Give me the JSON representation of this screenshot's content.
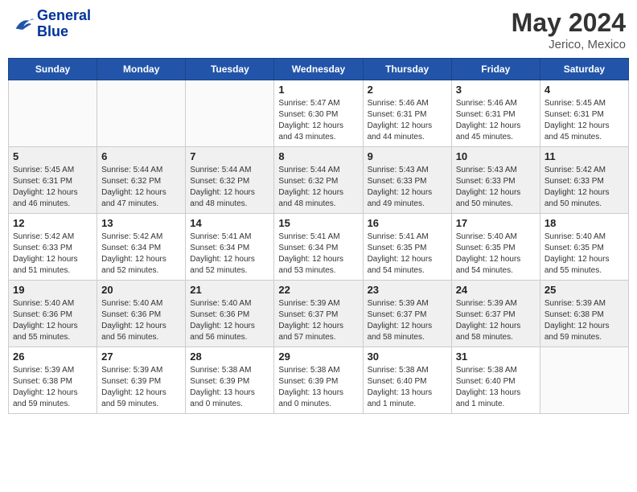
{
  "header": {
    "logo_line1": "General",
    "logo_line2": "Blue",
    "month_year": "May 2024",
    "location": "Jerico, Mexico"
  },
  "weekdays": [
    "Sunday",
    "Monday",
    "Tuesday",
    "Wednesday",
    "Thursday",
    "Friday",
    "Saturday"
  ],
  "weeks": [
    [
      {
        "day": "",
        "sunrise": "",
        "sunset": "",
        "daylight": ""
      },
      {
        "day": "",
        "sunrise": "",
        "sunset": "",
        "daylight": ""
      },
      {
        "day": "",
        "sunrise": "",
        "sunset": "",
        "daylight": ""
      },
      {
        "day": "1",
        "sunrise": "Sunrise: 5:47 AM",
        "sunset": "Sunset: 6:30 PM",
        "daylight": "Daylight: 12 hours and 43 minutes."
      },
      {
        "day": "2",
        "sunrise": "Sunrise: 5:46 AM",
        "sunset": "Sunset: 6:31 PM",
        "daylight": "Daylight: 12 hours and 44 minutes."
      },
      {
        "day": "3",
        "sunrise": "Sunrise: 5:46 AM",
        "sunset": "Sunset: 6:31 PM",
        "daylight": "Daylight: 12 hours and 45 minutes."
      },
      {
        "day": "4",
        "sunrise": "Sunrise: 5:45 AM",
        "sunset": "Sunset: 6:31 PM",
        "daylight": "Daylight: 12 hours and 45 minutes."
      }
    ],
    [
      {
        "day": "5",
        "sunrise": "Sunrise: 5:45 AM",
        "sunset": "Sunset: 6:31 PM",
        "daylight": "Daylight: 12 hours and 46 minutes."
      },
      {
        "day": "6",
        "sunrise": "Sunrise: 5:44 AM",
        "sunset": "Sunset: 6:32 PM",
        "daylight": "Daylight: 12 hours and 47 minutes."
      },
      {
        "day": "7",
        "sunrise": "Sunrise: 5:44 AM",
        "sunset": "Sunset: 6:32 PM",
        "daylight": "Daylight: 12 hours and 48 minutes."
      },
      {
        "day": "8",
        "sunrise": "Sunrise: 5:44 AM",
        "sunset": "Sunset: 6:32 PM",
        "daylight": "Daylight: 12 hours and 48 minutes."
      },
      {
        "day": "9",
        "sunrise": "Sunrise: 5:43 AM",
        "sunset": "Sunset: 6:33 PM",
        "daylight": "Daylight: 12 hours and 49 minutes."
      },
      {
        "day": "10",
        "sunrise": "Sunrise: 5:43 AM",
        "sunset": "Sunset: 6:33 PM",
        "daylight": "Daylight: 12 hours and 50 minutes."
      },
      {
        "day": "11",
        "sunrise": "Sunrise: 5:42 AM",
        "sunset": "Sunset: 6:33 PM",
        "daylight": "Daylight: 12 hours and 50 minutes."
      }
    ],
    [
      {
        "day": "12",
        "sunrise": "Sunrise: 5:42 AM",
        "sunset": "Sunset: 6:33 PM",
        "daylight": "Daylight: 12 hours and 51 minutes."
      },
      {
        "day": "13",
        "sunrise": "Sunrise: 5:42 AM",
        "sunset": "Sunset: 6:34 PM",
        "daylight": "Daylight: 12 hours and 52 minutes."
      },
      {
        "day": "14",
        "sunrise": "Sunrise: 5:41 AM",
        "sunset": "Sunset: 6:34 PM",
        "daylight": "Daylight: 12 hours and 52 minutes."
      },
      {
        "day": "15",
        "sunrise": "Sunrise: 5:41 AM",
        "sunset": "Sunset: 6:34 PM",
        "daylight": "Daylight: 12 hours and 53 minutes."
      },
      {
        "day": "16",
        "sunrise": "Sunrise: 5:41 AM",
        "sunset": "Sunset: 6:35 PM",
        "daylight": "Daylight: 12 hours and 54 minutes."
      },
      {
        "day": "17",
        "sunrise": "Sunrise: 5:40 AM",
        "sunset": "Sunset: 6:35 PM",
        "daylight": "Daylight: 12 hours and 54 minutes."
      },
      {
        "day": "18",
        "sunrise": "Sunrise: 5:40 AM",
        "sunset": "Sunset: 6:35 PM",
        "daylight": "Daylight: 12 hours and 55 minutes."
      }
    ],
    [
      {
        "day": "19",
        "sunrise": "Sunrise: 5:40 AM",
        "sunset": "Sunset: 6:36 PM",
        "daylight": "Daylight: 12 hours and 55 minutes."
      },
      {
        "day": "20",
        "sunrise": "Sunrise: 5:40 AM",
        "sunset": "Sunset: 6:36 PM",
        "daylight": "Daylight: 12 hours and 56 minutes."
      },
      {
        "day": "21",
        "sunrise": "Sunrise: 5:40 AM",
        "sunset": "Sunset: 6:36 PM",
        "daylight": "Daylight: 12 hours and 56 minutes."
      },
      {
        "day": "22",
        "sunrise": "Sunrise: 5:39 AM",
        "sunset": "Sunset: 6:37 PM",
        "daylight": "Daylight: 12 hours and 57 minutes."
      },
      {
        "day": "23",
        "sunrise": "Sunrise: 5:39 AM",
        "sunset": "Sunset: 6:37 PM",
        "daylight": "Daylight: 12 hours and 58 minutes."
      },
      {
        "day": "24",
        "sunrise": "Sunrise: 5:39 AM",
        "sunset": "Sunset: 6:37 PM",
        "daylight": "Daylight: 12 hours and 58 minutes."
      },
      {
        "day": "25",
        "sunrise": "Sunrise: 5:39 AM",
        "sunset": "Sunset: 6:38 PM",
        "daylight": "Daylight: 12 hours and 59 minutes."
      }
    ],
    [
      {
        "day": "26",
        "sunrise": "Sunrise: 5:39 AM",
        "sunset": "Sunset: 6:38 PM",
        "daylight": "Daylight: 12 hours and 59 minutes."
      },
      {
        "day": "27",
        "sunrise": "Sunrise: 5:39 AM",
        "sunset": "Sunset: 6:39 PM",
        "daylight": "Daylight: 12 hours and 59 minutes."
      },
      {
        "day": "28",
        "sunrise": "Sunrise: 5:38 AM",
        "sunset": "Sunset: 6:39 PM",
        "daylight": "Daylight: 13 hours and 0 minutes."
      },
      {
        "day": "29",
        "sunrise": "Sunrise: 5:38 AM",
        "sunset": "Sunset: 6:39 PM",
        "daylight": "Daylight: 13 hours and 0 minutes."
      },
      {
        "day": "30",
        "sunrise": "Sunrise: 5:38 AM",
        "sunset": "Sunset: 6:40 PM",
        "daylight": "Daylight: 13 hours and 1 minute."
      },
      {
        "day": "31",
        "sunrise": "Sunrise: 5:38 AM",
        "sunset": "Sunset: 6:40 PM",
        "daylight": "Daylight: 13 hours and 1 minute."
      },
      {
        "day": "",
        "sunrise": "",
        "sunset": "",
        "daylight": ""
      }
    ]
  ]
}
